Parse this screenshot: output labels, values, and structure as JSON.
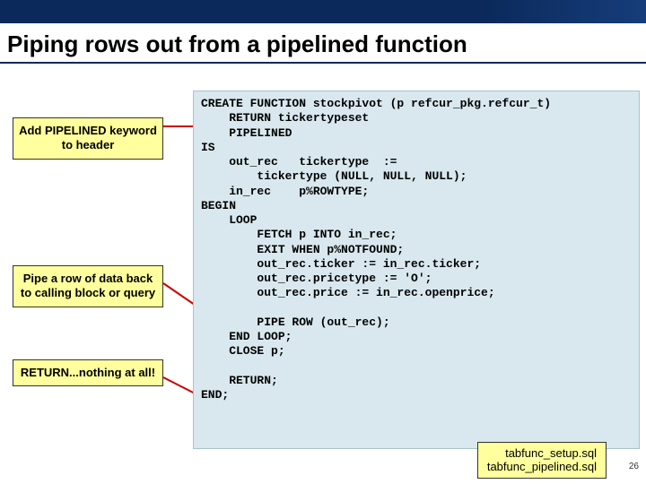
{
  "title": "Piping rows out from a pipelined function",
  "callouts": {
    "c1": "Add PIPELINED keyword to header",
    "c2": "Pipe a row of data back to calling block or query",
    "c3": "RETURN...nothing at all!"
  },
  "code": "CREATE FUNCTION stockpivot (p refcur_pkg.refcur_t)\n    RETURN tickertypeset\n    PIPELINED\nIS\n    out_rec   tickertype  :=\n        tickertype (NULL, NULL, NULL);\n    in_rec    p%ROWTYPE;\nBEGIN\n    LOOP\n        FETCH p INTO in_rec;\n        EXIT WHEN p%NOTFOUND;\n        out_rec.ticker := in_rec.ticker;\n        out_rec.pricetype := 'O';\n        out_rec.price := in_rec.openprice;\n\n        PIPE ROW (out_rec);\n    END LOOP;\n    CLOSE p;\n\n    RETURN;\nEND;",
  "footer": {
    "file1": "tabfunc_setup.sql",
    "file2": "tabfunc_pipelined.sql"
  },
  "page_number": "26"
}
